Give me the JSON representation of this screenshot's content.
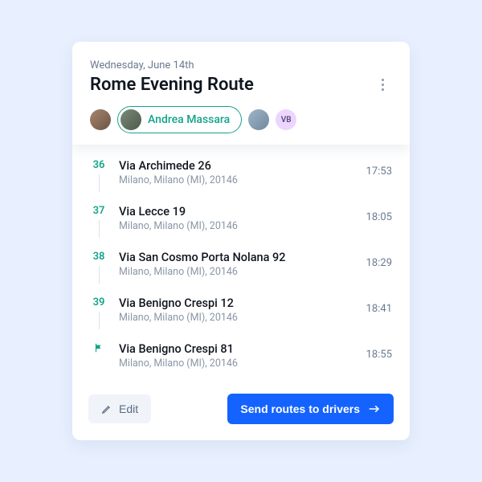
{
  "header": {
    "date": "Wednesday, June 14th",
    "title": "Rome Evening Route"
  },
  "drivers": {
    "selected_name": "Andrea Massara",
    "avatars": [
      {
        "initials": "",
        "cls": "a1"
      },
      {
        "initials": "",
        "cls": "a2",
        "selected": true
      },
      {
        "initials": "",
        "cls": "a3"
      },
      {
        "initials": "VB",
        "cls": "vb"
      }
    ]
  },
  "stops": [
    {
      "num": "36",
      "street": "Via Archimede 26",
      "city": "Milano, Milano (MI), 20146",
      "time": "17:53"
    },
    {
      "num": "37",
      "street": "Via Lecce 19",
      "city": "Milano, Milano (MI), 20146",
      "time": "18:05"
    },
    {
      "num": "38",
      "street": "Via San Cosmo Porta Nolana 92",
      "city": "Milano, Milano (MI), 20146",
      "time": "18:29"
    },
    {
      "num": "39",
      "street": "Via Benigno Crespi 12",
      "city": "Milano, Milano (MI), 20146",
      "time": "18:41"
    },
    {
      "num": "flag",
      "street": "Via Benigno Crespi 81",
      "city": "Milano, Milano (MI), 20146",
      "time": "18:55"
    }
  ],
  "footer": {
    "edit_label": "Edit",
    "send_label": "Send routes to drivers"
  }
}
